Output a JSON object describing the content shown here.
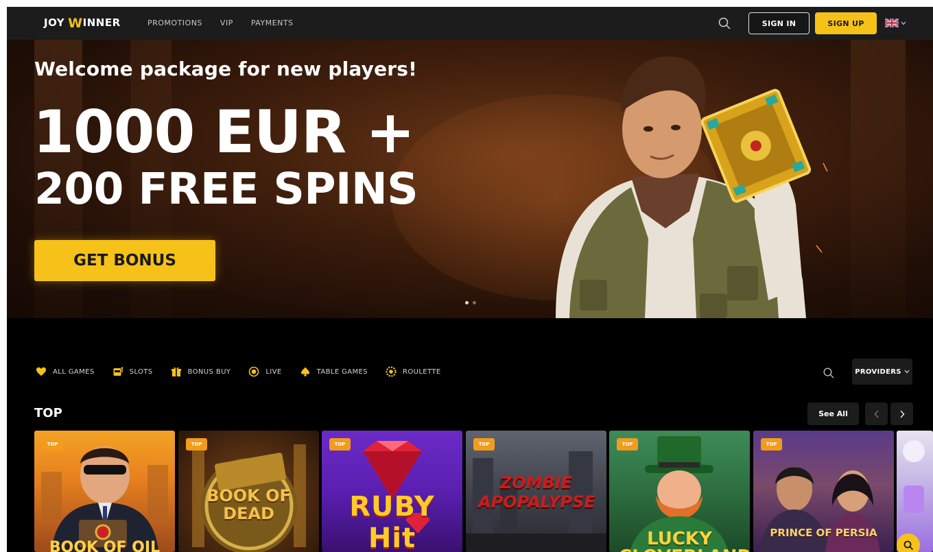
{
  "header": {
    "logo_joy": "JOY",
    "logo_w": "W",
    "logo_inner": "INNER",
    "nav": [
      "PROMOTIONS",
      "VIP",
      "PAYMENTS"
    ],
    "sign_in": "SIGN IN",
    "sign_up": "SIGN UP",
    "language_icon": "uk-flag-icon"
  },
  "hero": {
    "subtitle": "Welcome package for new players!",
    "amount": "1000 EUR +",
    "spins": "200 FREE SPINS",
    "cta": "GET BONUS",
    "slides_total": 2,
    "slide_active": 1
  },
  "categories": [
    {
      "label": "ALL GAMES",
      "icon": "heart-icon"
    },
    {
      "label": "SLOTS",
      "icon": "slot-machine-icon"
    },
    {
      "label": "BONUS BUY",
      "icon": "gift-icon"
    },
    {
      "label": "LIVE",
      "icon": "live-icon"
    },
    {
      "label": "TABLE GAMES",
      "icon": "spade-icon"
    },
    {
      "label": "ROULETTE",
      "icon": "roulette-icon"
    }
  ],
  "providers_label": "PROVIDERS",
  "section": {
    "title": "TOP",
    "see_all": "See All"
  },
  "games": [
    {
      "badge": "TOP",
      "title": "BOOK OF OIL"
    },
    {
      "badge": "TOP",
      "title": "BOOK OF DEAD"
    },
    {
      "badge": "TOP",
      "title": "RUBY Hit"
    },
    {
      "badge": "TOP",
      "title": "ZOMBIE APOPALYPSE"
    },
    {
      "badge": "TOP",
      "title": "LUCKY CLOVERLAND"
    },
    {
      "badge": "TOP",
      "title": "PRINCE OF PERSIA"
    }
  ],
  "colors": {
    "accent": "#f6c21a",
    "badge": "#f39b1c",
    "header_bg": "#1c1c1c",
    "page_bg": "#000000"
  }
}
